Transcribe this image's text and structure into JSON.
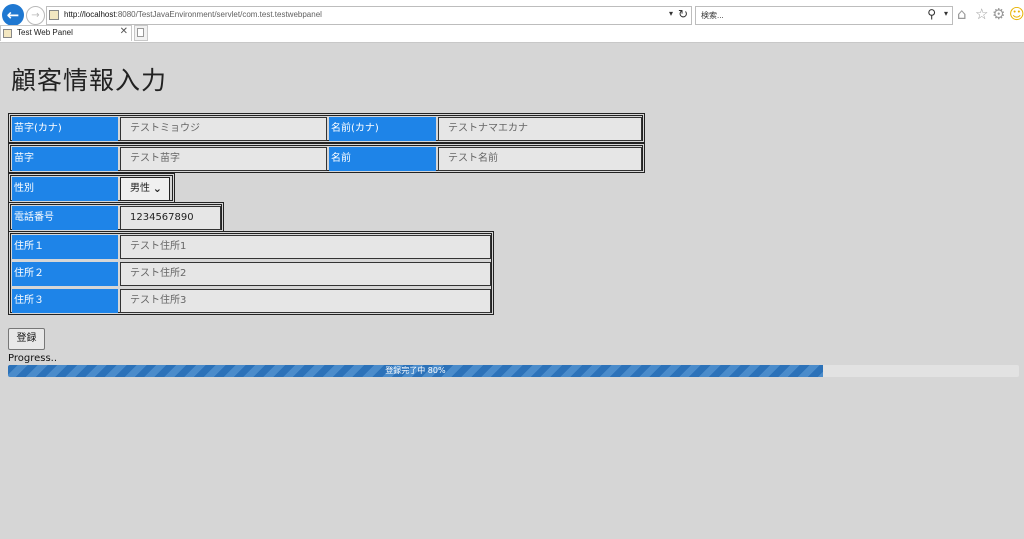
{
  "browser": {
    "url_host": "http://localhost",
    "url_rest": ":8080/TestJavaEnvironment/servlet/com.test.testwebpanel",
    "search_placeholder": "検索...",
    "tab_title": "Test Web Panel",
    "icons": [
      "back-arrow-icon",
      "forward-arrow-icon",
      "refresh-icon",
      "search-icon",
      "home-icon",
      "star-icon",
      "gear-icon",
      "smiley-icon"
    ]
  },
  "page": {
    "title": "顧客情報入力"
  },
  "form": {
    "last_name_kana_label": "苗字(カナ)",
    "last_name_kana_value": "テストミョウジ",
    "first_name_kana_label": "名前(カナ)",
    "first_name_kana_value": "テストナマエカナ",
    "last_name_label": "苗字",
    "last_name_value": "テスト苗字",
    "first_name_label": "名前",
    "first_name_value": "テスト名前",
    "gender_label": "性別",
    "gender_value": "男性",
    "phone_label": "電話番号",
    "phone_value": "1234567890",
    "address1_label": "住所１",
    "address1_value": "テスト住所1",
    "address2_label": "住所２",
    "address2_value": "テスト住所2",
    "address3_label": "住所３",
    "address3_value": "テスト住所3"
  },
  "actions": {
    "submit_label": "登録"
  },
  "progress": {
    "label": "Progress..",
    "text": "登録完了中 80%",
    "percent": 80
  },
  "colors": {
    "label_bg": "#1e84e8",
    "progress_fill": "#2c72b9",
    "page_bg": "#d6d6d6"
  }
}
